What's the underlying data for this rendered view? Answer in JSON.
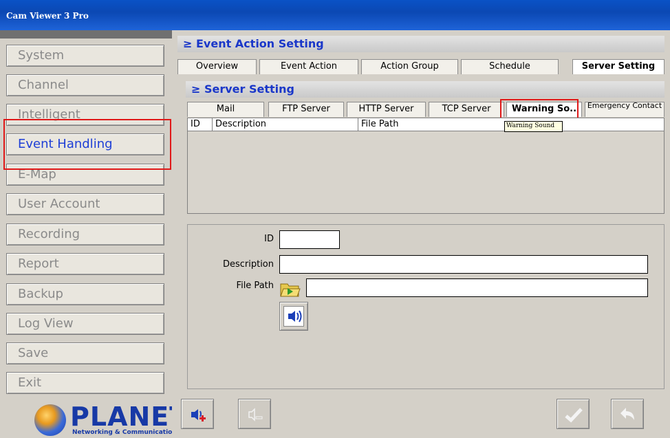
{
  "window": {
    "title": "Cam Viewer 3 Pro"
  },
  "sidebar": {
    "items": [
      {
        "label": "System"
      },
      {
        "label": "Channel"
      },
      {
        "label": "Intelligent"
      },
      {
        "label": "Event Handling"
      },
      {
        "label": "E-Map"
      },
      {
        "label": "User Account"
      },
      {
        "label": "Recording"
      },
      {
        "label": "Report"
      },
      {
        "label": "Backup"
      },
      {
        "label": "Log View"
      },
      {
        "label": "Save"
      },
      {
        "label": "Exit"
      }
    ],
    "logo": {
      "brand": "PLANET",
      "tagline": "Networking & Communication"
    }
  },
  "event_action": {
    "header": "Event Action Setting",
    "tabs": [
      "Overview",
      "Event Action",
      "Action Group",
      "Schedule",
      "Server Setting"
    ],
    "active_tab": "Server Setting"
  },
  "server_setting": {
    "header": "Server Setting",
    "tabs": [
      "Mail",
      "FTP Server",
      "HTTP Server",
      "TCP Server",
      "Warning So..",
      "Emergency Contact"
    ],
    "active_tab": "Warning So..",
    "tooltip": "Warning Sound",
    "columns": [
      "ID",
      "Description",
      "File Path"
    ],
    "rows": []
  },
  "form": {
    "id_label": "ID",
    "id_value": "",
    "description_label": "Description",
    "description_value": "",
    "file_path_label": "File Path",
    "file_path_value": ""
  },
  "icons": {
    "folder": "folder-open-icon",
    "play": "speaker-icon",
    "add_sound": "speaker-add-icon",
    "delete_sound": "speaker-delete-icon",
    "confirm": "checkmark-icon",
    "undo": "undo-icon"
  },
  "colors": {
    "accent": "#1a37c9",
    "highlight": "#e01919",
    "title_bar": "#0b48b3"
  }
}
